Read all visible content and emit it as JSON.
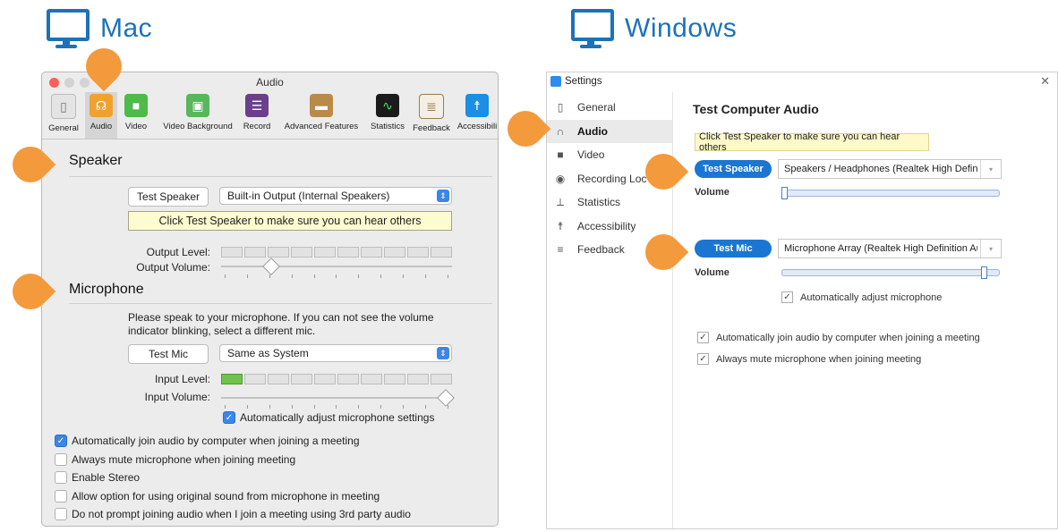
{
  "headings": {
    "mac": "Mac",
    "windows": "Windows"
  },
  "colors": {
    "accent_blue": "#1d72b8",
    "callout_orange": "#f39a3d",
    "mac_check": "#3b86e8",
    "win_button": "#1a76d2"
  },
  "mac": {
    "window_title": "Audio",
    "toolbar": [
      {
        "label": "General",
        "icon": "switch-icon"
      },
      {
        "label": "Audio",
        "icon": "headphones-icon"
      },
      {
        "label": "Video",
        "icon": "video-camera-icon"
      },
      {
        "label": "Video Background",
        "icon": "image-icon"
      },
      {
        "label": "Record",
        "icon": "film-icon"
      },
      {
        "label": "Advanced Features",
        "icon": "wallet-icon"
      },
      {
        "label": "Statistics",
        "icon": "waveform-icon"
      },
      {
        "label": "Feedback",
        "icon": "clipboard-icon"
      },
      {
        "label": "Accessibili",
        "icon": "accessibility-icon"
      }
    ],
    "speaker": {
      "title": "Speaker",
      "test_button": "Test Speaker",
      "device": "Built-in Output (Internal Speakers)",
      "tooltip": "Click Test Speaker to make sure you can hear others",
      "output_level_label": "Output Level:",
      "output_volume_label": "Output Volume:",
      "output_level_active_segments": 0,
      "output_volume_fraction": 0.2
    },
    "microphone": {
      "title": "Microphone",
      "instructions_line1": "Please speak to your microphone. If you can not see the volume",
      "instructions_line2": "indicator blinking, select a different mic.",
      "test_button": "Test Mic",
      "device": "Same as System",
      "input_level_label": "Input Level:",
      "input_volume_label": "Input Volume:",
      "input_level_active_segments": 1,
      "input_volume_fraction": 1.0,
      "auto_adjust_label": "Automatically adjust microphone settings",
      "auto_adjust_checked": true
    },
    "options": [
      {
        "label": "Automatically join audio by computer when joining a meeting",
        "checked": true
      },
      {
        "label": "Always mute microphone when joining meeting",
        "checked": false
      },
      {
        "label": "Enable Stereo",
        "checked": false
      },
      {
        "label": "Allow option for using original sound from microphone in meeting",
        "checked": false
      },
      {
        "label": "Do not prompt joining audio when I join a meeting using 3rd party audio",
        "checked": false
      }
    ]
  },
  "windows": {
    "window_title": "Settings",
    "close_glyph": "✕",
    "nav": [
      {
        "label": "General",
        "icon": "phone-icon"
      },
      {
        "label": "Audio",
        "icon": "headphones-icon"
      },
      {
        "label": "Video",
        "icon": "video-camera-icon"
      },
      {
        "label": "Recording Loc",
        "icon": "record-icon"
      },
      {
        "label": "Statistics",
        "icon": "pulse-icon"
      },
      {
        "label": "Accessibility",
        "icon": "accessibility-icon"
      },
      {
        "label": "Feedback",
        "icon": "feedback-icon"
      }
    ],
    "selected_nav": "Audio",
    "panel_title": "Test Computer Audio",
    "tooltip": "Click Test Speaker to make sure you can hear others",
    "test_speaker": "Test Speaker",
    "speaker_device": "Speakers / Headphones (Realtek High Definitic",
    "volume_label": "Volume",
    "speaker_volume_fraction": 0.0,
    "test_mic": "Test Mic",
    "mic_device": "Microphone Array (Realtek High Definition Au",
    "mic_volume_label": "Volume",
    "mic_volume_fraction": 0.95,
    "auto_adjust_label": "Automatically adjust microphone",
    "options": [
      {
        "label": "Automatically join audio by computer when joining a meeting",
        "checked": true
      },
      {
        "label": "Always mute microphone when joining meeting",
        "checked": true
      }
    ]
  }
}
